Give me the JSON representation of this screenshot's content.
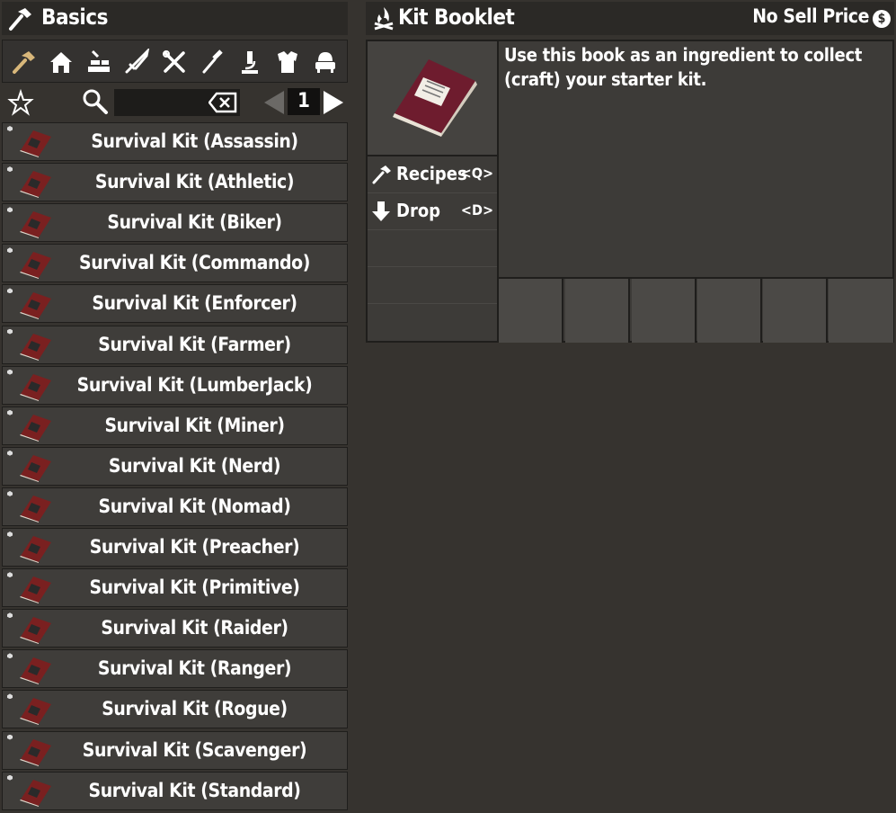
{
  "left": {
    "title": "Basics",
    "categories": [
      "basics-hammer",
      "building-house",
      "workstation",
      "weapons",
      "tools",
      "food-fork",
      "science",
      "armor",
      "furniture"
    ],
    "page": "1",
    "items": [
      "Survival Kit (Assassin)",
      "Survival Kit (Athletic)",
      "Survival Kit (Biker)",
      "Survival Kit (Commando)",
      "Survival Kit (Enforcer)",
      "Survival Kit (Farmer)",
      "Survival Kit (LumberJack)",
      "Survival Kit (Miner)",
      "Survival Kit (Nerd)",
      "Survival Kit (Nomad)",
      "Survival Kit (Preacher)",
      "Survival Kit (Primitive)",
      "Survival Kit (Raider)",
      "Survival Kit (Ranger)",
      "Survival Kit (Rogue)",
      "Survival Kit (Scavenger)",
      "Survival Kit (Standard)"
    ]
  },
  "right": {
    "title": "Kit Booklet",
    "price": "No Sell Price",
    "price_icon": "$",
    "description": "Use this book as an ingredient to collect (craft) your starter kit.",
    "actions": [
      {
        "label": "Recipes",
        "key": "<Q>"
      },
      {
        "label": "Drop",
        "key": "<D>"
      }
    ]
  },
  "colors": {
    "background": "#36332f",
    "header": "#2b2926",
    "row": "#3f3d3a",
    "book": "#7a2020"
  }
}
